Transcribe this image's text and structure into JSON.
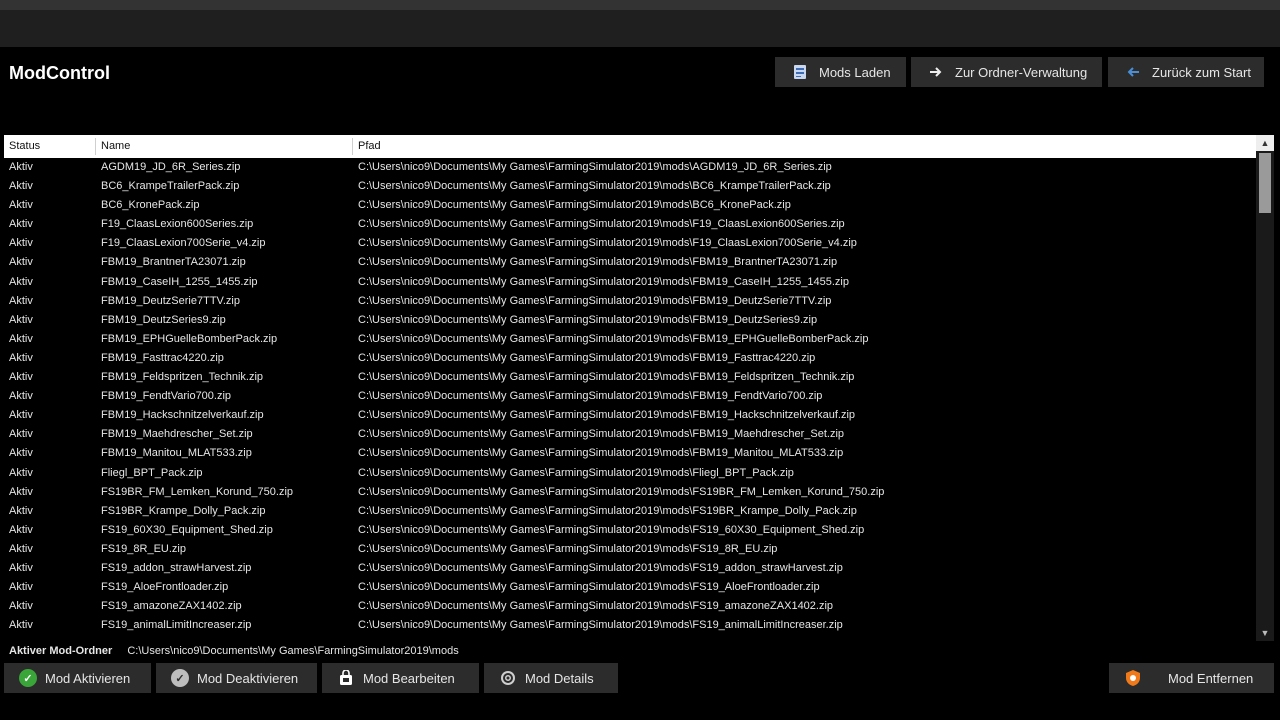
{
  "app": {
    "title": "ModControl"
  },
  "top_buttons": {
    "load": "Mods Laden",
    "folders": "Zur Ordner-Verwaltung",
    "back": "Zurück zum Start"
  },
  "table": {
    "headers": {
      "status": "Status",
      "name": "Name",
      "path": "Pfad"
    },
    "rows": [
      {
        "status": "Aktiv",
        "name": "AGDM19_JD_6R_Series.zip",
        "path": "C:\\Users\\nico9\\Documents\\My Games\\FarmingSimulator2019\\mods\\AGDM19_JD_6R_Series.zip"
      },
      {
        "status": "Aktiv",
        "name": "BC6_KrampeTrailerPack.zip",
        "path": "C:\\Users\\nico9\\Documents\\My Games\\FarmingSimulator2019\\mods\\BC6_KrampeTrailerPack.zip"
      },
      {
        "status": "Aktiv",
        "name": "BC6_KronePack.zip",
        "path": "C:\\Users\\nico9\\Documents\\My Games\\FarmingSimulator2019\\mods\\BC6_KronePack.zip"
      },
      {
        "status": "Aktiv",
        "name": "F19_ClaasLexion600Series.zip",
        "path": "C:\\Users\\nico9\\Documents\\My Games\\FarmingSimulator2019\\mods\\F19_ClaasLexion600Series.zip"
      },
      {
        "status": "Aktiv",
        "name": "F19_ClaasLexion700Serie_v4.zip",
        "path": "C:\\Users\\nico9\\Documents\\My Games\\FarmingSimulator2019\\mods\\F19_ClaasLexion700Serie_v4.zip"
      },
      {
        "status": "Aktiv",
        "name": "FBM19_BrantnerTA23071.zip",
        "path": "C:\\Users\\nico9\\Documents\\My Games\\FarmingSimulator2019\\mods\\FBM19_BrantnerTA23071.zip"
      },
      {
        "status": "Aktiv",
        "name": "FBM19_CaseIH_1255_1455.zip",
        "path": "C:\\Users\\nico9\\Documents\\My Games\\FarmingSimulator2019\\mods\\FBM19_CaseIH_1255_1455.zip"
      },
      {
        "status": "Aktiv",
        "name": "FBM19_DeutzSerie7TTV.zip",
        "path": "C:\\Users\\nico9\\Documents\\My Games\\FarmingSimulator2019\\mods\\FBM19_DeutzSerie7TTV.zip"
      },
      {
        "status": "Aktiv",
        "name": "FBM19_DeutzSeries9.zip",
        "path": "C:\\Users\\nico9\\Documents\\My Games\\FarmingSimulator2019\\mods\\FBM19_DeutzSeries9.zip"
      },
      {
        "status": "Aktiv",
        "name": "FBM19_EPHGuelleBomberPack.zip",
        "path": "C:\\Users\\nico9\\Documents\\My Games\\FarmingSimulator2019\\mods\\FBM19_EPHGuelleBomberPack.zip"
      },
      {
        "status": "Aktiv",
        "name": "FBM19_Fasttrac4220.zip",
        "path": "C:\\Users\\nico9\\Documents\\My Games\\FarmingSimulator2019\\mods\\FBM19_Fasttrac4220.zip"
      },
      {
        "status": "Aktiv",
        "name": "FBM19_Feldspritzen_Technik.zip",
        "path": "C:\\Users\\nico9\\Documents\\My Games\\FarmingSimulator2019\\mods\\FBM19_Feldspritzen_Technik.zip"
      },
      {
        "status": "Aktiv",
        "name": "FBM19_FendtVario700.zip",
        "path": "C:\\Users\\nico9\\Documents\\My Games\\FarmingSimulator2019\\mods\\FBM19_FendtVario700.zip"
      },
      {
        "status": "Aktiv",
        "name": "FBM19_Hackschnitzelverkauf.zip",
        "path": "C:\\Users\\nico9\\Documents\\My Games\\FarmingSimulator2019\\mods\\FBM19_Hackschnitzelverkauf.zip"
      },
      {
        "status": "Aktiv",
        "name": "FBM19_Maehdrescher_Set.zip",
        "path": "C:\\Users\\nico9\\Documents\\My Games\\FarmingSimulator2019\\mods\\FBM19_Maehdrescher_Set.zip"
      },
      {
        "status": "Aktiv",
        "name": "FBM19_Manitou_MLAT533.zip",
        "path": "C:\\Users\\nico9\\Documents\\My Games\\FarmingSimulator2019\\mods\\FBM19_Manitou_MLAT533.zip"
      },
      {
        "status": "Aktiv",
        "name": "Fliegl_BPT_Pack.zip",
        "path": "C:\\Users\\nico9\\Documents\\My Games\\FarmingSimulator2019\\mods\\Fliegl_BPT_Pack.zip"
      },
      {
        "status": "Aktiv",
        "name": "FS19BR_FM_Lemken_Korund_750.zip",
        "path": "C:\\Users\\nico9\\Documents\\My Games\\FarmingSimulator2019\\mods\\FS19BR_FM_Lemken_Korund_750.zip"
      },
      {
        "status": "Aktiv",
        "name": "FS19BR_Krampe_Dolly_Pack.zip",
        "path": "C:\\Users\\nico9\\Documents\\My Games\\FarmingSimulator2019\\mods\\FS19BR_Krampe_Dolly_Pack.zip"
      },
      {
        "status": "Aktiv",
        "name": "FS19_60X30_Equipment_Shed.zip",
        "path": "C:\\Users\\nico9\\Documents\\My Games\\FarmingSimulator2019\\mods\\FS19_60X30_Equipment_Shed.zip"
      },
      {
        "status": "Aktiv",
        "name": "FS19_8R_EU.zip",
        "path": "C:\\Users\\nico9\\Documents\\My Games\\FarmingSimulator2019\\mods\\FS19_8R_EU.zip"
      },
      {
        "status": "Aktiv",
        "name": "FS19_addon_strawHarvest.zip",
        "path": "C:\\Users\\nico9\\Documents\\My Games\\FarmingSimulator2019\\mods\\FS19_addon_strawHarvest.zip"
      },
      {
        "status": "Aktiv",
        "name": "FS19_AloeFrontloader.zip",
        "path": "C:\\Users\\nico9\\Documents\\My Games\\FarmingSimulator2019\\mods\\FS19_AloeFrontloader.zip"
      },
      {
        "status": "Aktiv",
        "name": "FS19_amazoneZAX1402.zip",
        "path": "C:\\Users\\nico9\\Documents\\My Games\\FarmingSimulator2019\\mods\\FS19_amazoneZAX1402.zip"
      },
      {
        "status": "Aktiv",
        "name": "FS19_animalLimitIncreaser.zip",
        "path": "C:\\Users\\nico9\\Documents\\My Games\\FarmingSimulator2019\\mods\\FS19_animalLimitIncreaser.zip"
      }
    ]
  },
  "footer": {
    "active_folder_label": "Aktiver Mod-Ordner",
    "active_folder_path": "C:\\Users\\nico9\\Documents\\My Games\\FarmingSimulator2019\\mods"
  },
  "bottom_buttons": {
    "activate": "Mod Aktivieren",
    "deactivate": "Mod Deaktivieren",
    "edit": "Mod Bearbeiten",
    "details": "Mod Details",
    "remove": "Mod Entfernen"
  },
  "icons": {
    "load": "document-load-icon",
    "folders": "arrow-right-icon",
    "back": "arrow-left-icon",
    "activate": "check-circle-icon",
    "deactivate": "check-circle-gray-icon",
    "edit": "shopping-bag-icon",
    "details": "gear-icon",
    "remove": "shield-icon"
  },
  "colors": {
    "background": "#000000",
    "button": "#2c2c2c",
    "accent_green": "#3aa63a",
    "accent_orange": "#f07a1a",
    "accent_blue": "#4a8fd6"
  }
}
